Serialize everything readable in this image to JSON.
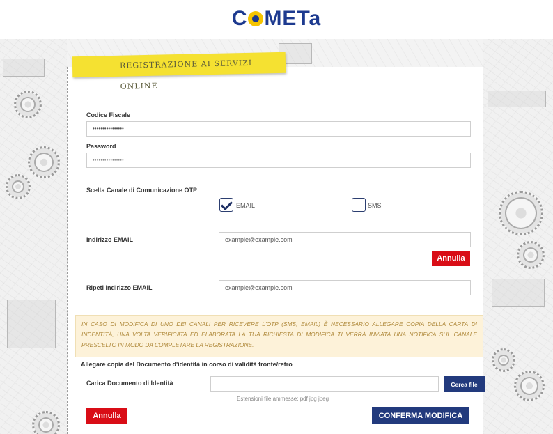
{
  "logo": {
    "prefix": "CO",
    "suffix": "METa"
  },
  "banner": {
    "title": "Registrazione ai servizi online"
  },
  "form": {
    "codice_fiscale": {
      "label": "Codice Fiscale",
      "value": "••••••••••••••••"
    },
    "password": {
      "label": "Password",
      "value": "••••••••••••••••"
    },
    "otp": {
      "label": "Scelta Canale di Comunicazione OTP",
      "email_label": "EMAIL",
      "sms_label": "SMS",
      "email_checked": true,
      "sms_checked": false
    },
    "email": {
      "label": "Indirizzo EMAIL",
      "placeholder": "example@example.com"
    },
    "annulla_email": "Annulla",
    "repeat_email": {
      "label": "Ripeti Indirizzo EMAIL",
      "placeholder": "example@example.com"
    },
    "notice": "IN CASO DI MODIFICA DI UNO DEI CANALI PER RICEVERE L'OTP (SMS, EMAIL) È NECESSARIO ALLEGARE COPIA DELLA CARTA DI INDENTITÀ, UNA VOLTA VERIFICATA ED ELABORATA LA TUA RICHIESTA DI MODIFICA TI VERRÀ INVIATA UNA NOTIFICA SUL CANALE PRESCELTO IN MODO DA COMPLETARE LA REGISTRAZIONE.",
    "attach_title": "Allegare copia del Documento d'identità in corso di validità fronte/retro",
    "upload": {
      "label": "Carica Documento di Identità",
      "button": "Cerca file",
      "hint": "Estensioni file ammesse: pdf jpg jpeg"
    },
    "cancel_button": "Annulla",
    "confirm_button": "CONFERMA MODIFICA"
  },
  "colors": {
    "accent_blue": "#223a7d",
    "accent_red": "#d90d16",
    "banner_yellow": "#f5e131",
    "notice_bg": "#fdf2d9"
  }
}
